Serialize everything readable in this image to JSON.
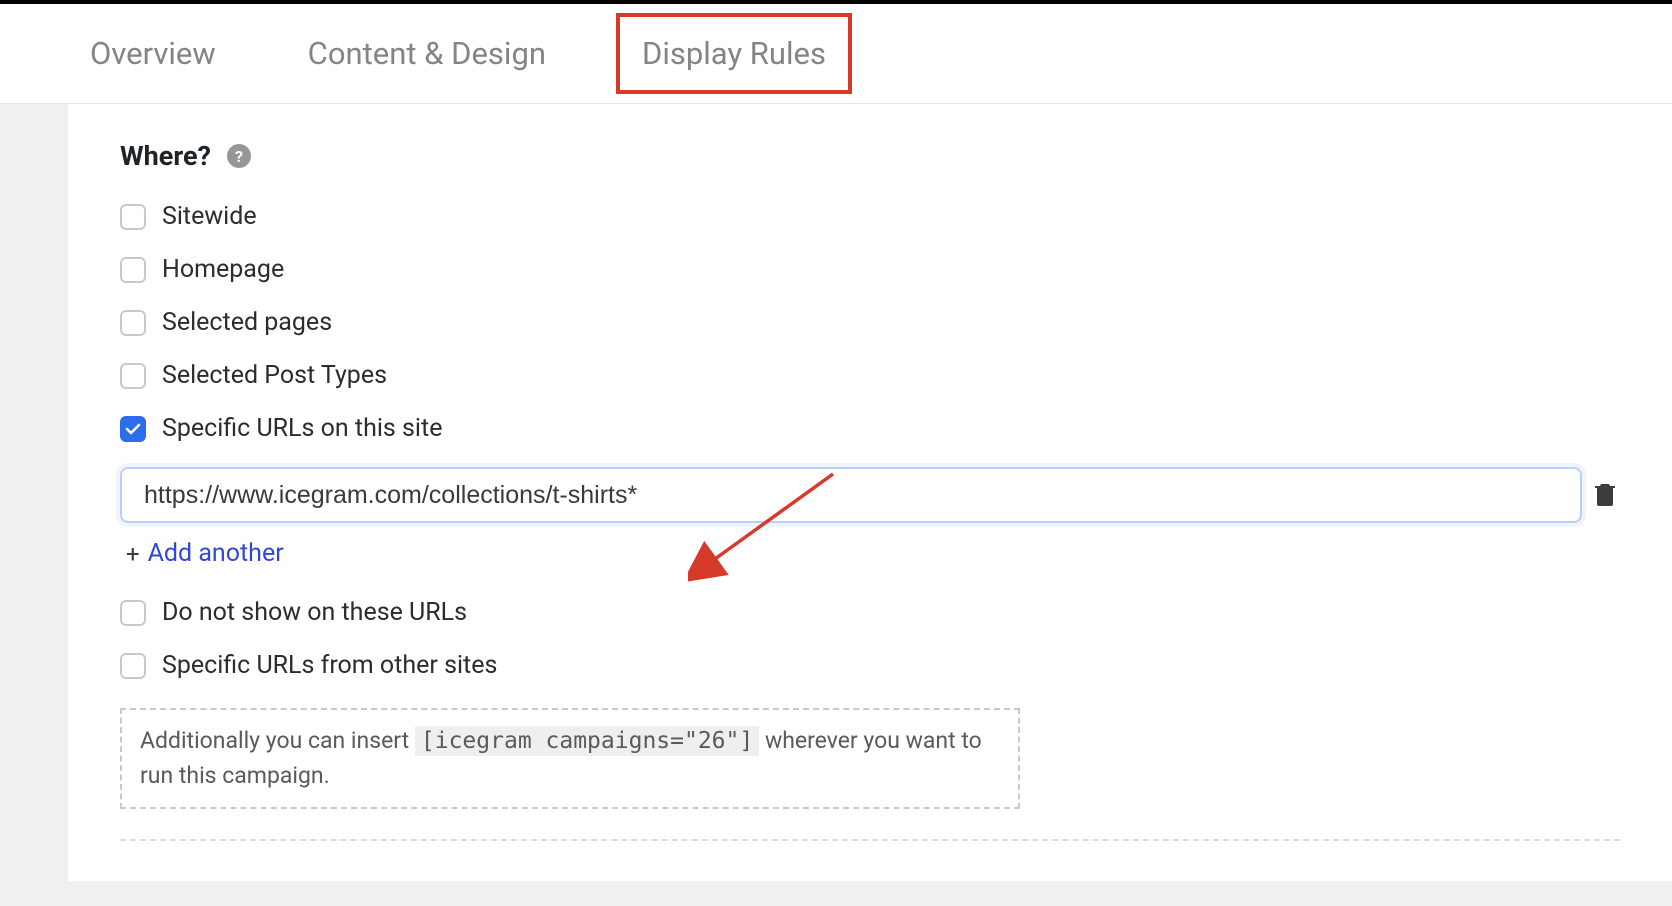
{
  "tabs": {
    "overview": "Overview",
    "content_design": "Content & Design",
    "display_rules": "Display Rules"
  },
  "where": {
    "title": "Where?",
    "help_glyph": "?",
    "options": {
      "sitewide": {
        "label": "Sitewide",
        "checked": false
      },
      "homepage": {
        "label": "Homepage",
        "checked": false
      },
      "selected_pages": {
        "label": "Selected pages",
        "checked": false
      },
      "selected_post_types": {
        "label": "Selected Post Types",
        "checked": false
      },
      "specific_urls": {
        "label": "Specific URLs on this site",
        "checked": true
      },
      "do_not_show": {
        "label": "Do not show on these URLs",
        "checked": false
      },
      "other_sites": {
        "label": "Specific URLs from other sites",
        "checked": false
      }
    },
    "url_value": "https://www.icegram.com/collections/t-shirts*",
    "add_another": "Add another",
    "plus_glyph": "+"
  },
  "info": {
    "prefix": "Additionally you can insert ",
    "code": "[icegram campaigns=\"26\"]",
    "suffix": " wherever you want to run this campaign."
  }
}
